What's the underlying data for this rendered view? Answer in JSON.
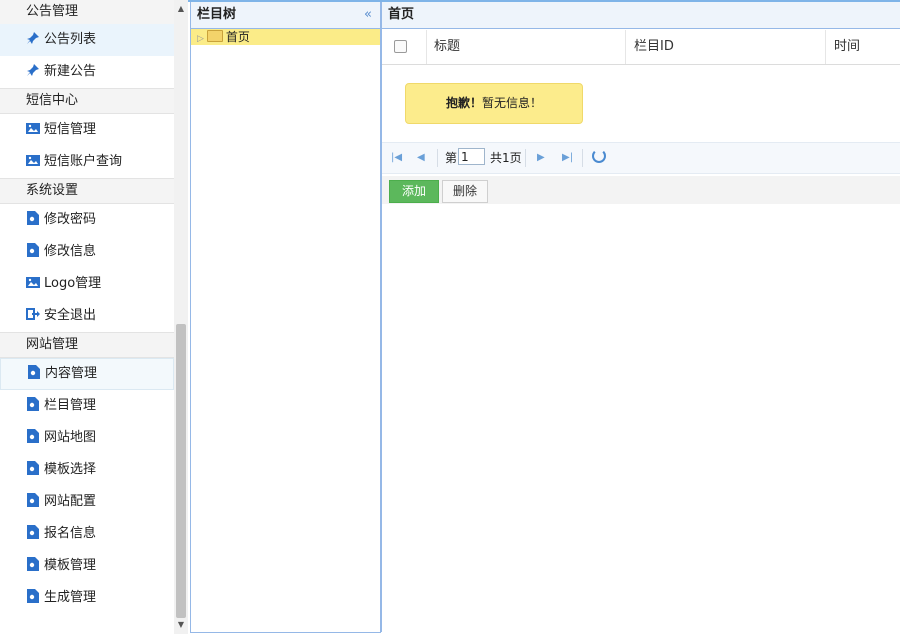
{
  "sidebar": {
    "sections": [
      {
        "title": "公告管理",
        "items": [
          {
            "label": "公告列表",
            "icon": "pin-icon",
            "active": true
          },
          {
            "label": "新建公告",
            "icon": "pin-icon"
          }
        ]
      },
      {
        "title": "短信中心",
        "items": [
          {
            "label": "短信管理",
            "icon": "picture-icon"
          },
          {
            "label": "短信账户查询",
            "icon": "picture-icon"
          }
        ]
      },
      {
        "title": "系统设置",
        "items": [
          {
            "label": "修改密码",
            "icon": "file-icon"
          },
          {
            "label": "修改信息",
            "icon": "file-icon"
          },
          {
            "label": "Logo管理",
            "icon": "picture-icon"
          },
          {
            "label": "安全退出",
            "icon": "logout-icon"
          }
        ]
      },
      {
        "title": "网站管理",
        "items": [
          {
            "label": "内容管理",
            "icon": "file-icon",
            "active": true
          },
          {
            "label": "栏目管理",
            "icon": "file-icon"
          },
          {
            "label": "网站地图",
            "icon": "file-icon"
          },
          {
            "label": "模板选择",
            "icon": "file-icon"
          },
          {
            "label": "网站配置",
            "icon": "file-icon"
          },
          {
            "label": "报名信息",
            "icon": "file-icon"
          },
          {
            "label": "模板管理",
            "icon": "file-icon"
          },
          {
            "label": "生成管理",
            "icon": "file-icon"
          }
        ]
      }
    ]
  },
  "tree": {
    "title": "栏目树",
    "collapse_icon": "«",
    "nodes": [
      {
        "label": "首页"
      }
    ]
  },
  "main": {
    "title": "首页",
    "columns": [
      "标题",
      "栏目ID",
      "时间"
    ],
    "tip_bold": "抱歉！",
    "tip_text": "暂无信息！",
    "pager": {
      "page_prefix": "第",
      "page_value": "1",
      "page_suffix": "共1页"
    },
    "buttons": {
      "add": "添加",
      "delete": "删除"
    }
  },
  "colors": {
    "accent": "#95b8e7",
    "add_button": "#5cb85c",
    "tip_bg": "#fcec8c",
    "tree_selected": "#fbec88"
  }
}
